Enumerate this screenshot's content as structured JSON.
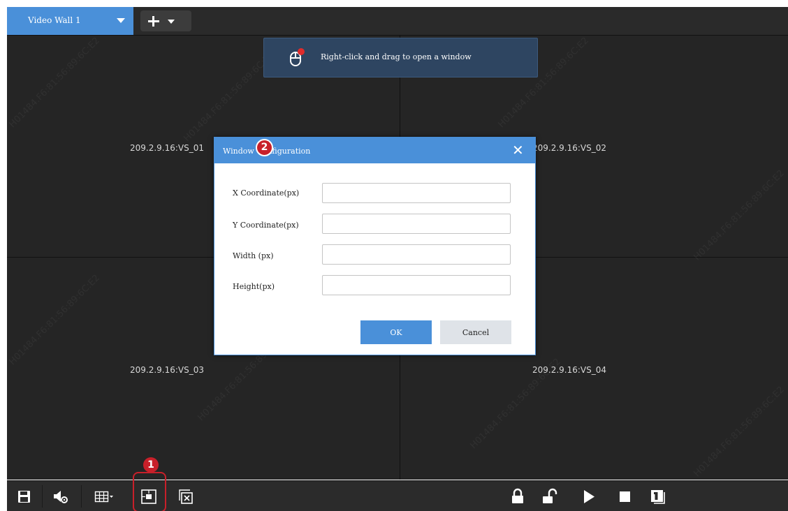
{
  "tabs": [
    {
      "label": "Video Wall 1"
    }
  ],
  "hint": {
    "text": "Right-click and drag to open a window"
  },
  "screens": [
    {
      "label": "209.2.9.16:VS_01"
    },
    {
      "label": "209.2.9.16:VS_02"
    },
    {
      "label": "209.2.9.16:VS_03"
    },
    {
      "label": "209.2.9.16:VS_04"
    }
  ],
  "watermark": "H01484.F6:81:56:89:6C:E2",
  "dialog": {
    "title": "Window Configuration",
    "fields": [
      {
        "label": "X Coordinate(px)",
        "value": ""
      },
      {
        "label": "Y Coordinate(px)",
        "value": ""
      },
      {
        "label": "Width (px)",
        "value": ""
      },
      {
        "label": "Height(px)",
        "value": ""
      }
    ],
    "ok": "OK",
    "cancel": "Cancel"
  },
  "callouts": {
    "one": "1",
    "two": "2"
  },
  "toolbar": {
    "left": [
      "save-icon",
      "audio-settings-icon",
      "layout-grid-icon",
      "open-window-icon",
      "close-window-icon"
    ],
    "right": [
      "lock-icon",
      "unlock-icon",
      "play-icon",
      "stop-icon",
      "single-screen-icon"
    ]
  },
  "colors": {
    "accent": "#4a90d9",
    "wall": "#252525",
    "callout": "#c8202a",
    "hint_bg": "#2e4561"
  }
}
